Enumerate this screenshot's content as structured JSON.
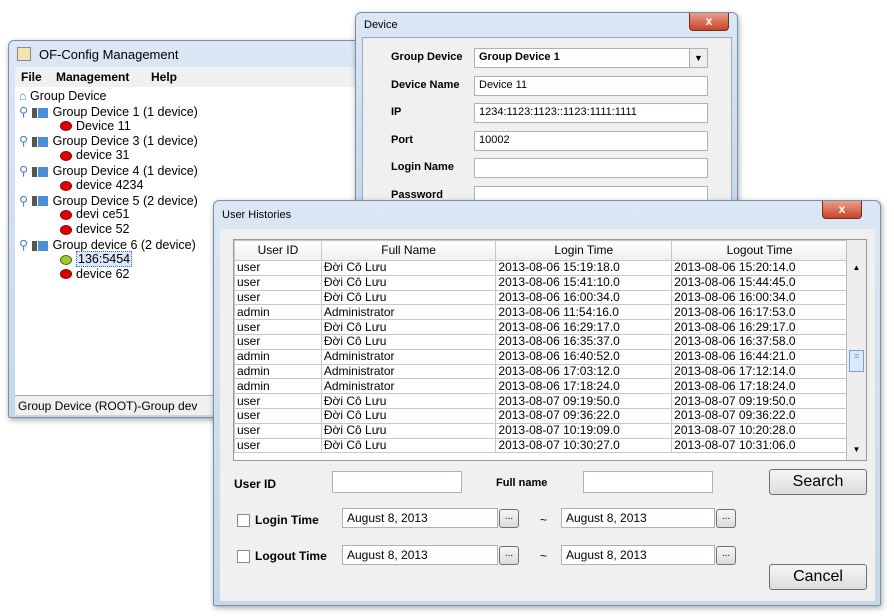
{
  "main_window": {
    "title": "OF-Config Management",
    "menu": [
      "File",
      "Management",
      "Help"
    ],
    "tree": {
      "root": "Group Device",
      "groups": [
        {
          "label": "Group Device 1 (1 device)",
          "devices": [
            {
              "name": "Device 11",
              "status": "offline"
            }
          ]
        },
        {
          "label": "Group Device 3 (1 device)",
          "devices": [
            {
              "name": "device 31",
              "status": "offline"
            }
          ]
        },
        {
          "label": "Group Device 4 (1 device)",
          "devices": [
            {
              "name": "device 4234",
              "status": "offline"
            }
          ]
        },
        {
          "label": "Group Device 5 (2 device)",
          "devices": [
            {
              "name": "devi ce51",
              "status": "offline"
            },
            {
              "name": "device 52",
              "status": "offline"
            }
          ]
        },
        {
          "label": "Group device 6 (2 device)",
          "devices": [
            {
              "name": "136:5454",
              "status": "online",
              "selected": true
            },
            {
              "name": "device 62",
              "status": "offline"
            }
          ]
        }
      ]
    },
    "status": "Group Device (ROOT)-Group dev"
  },
  "device_dialog": {
    "title": "Device",
    "close": "x",
    "fields": [
      {
        "label": "Group Device",
        "value": "Group Device 1",
        "type": "select"
      },
      {
        "label": "Device Name",
        "value": "Device 11"
      },
      {
        "label": "IP",
        "value": "1234:1123:1123::1123:1111:1111"
      },
      {
        "label": "Port",
        "value": "10002"
      },
      {
        "label": "Login Name",
        "value": ""
      },
      {
        "label": "Password",
        "value": ""
      }
    ]
  },
  "histories": {
    "title": "User Histories",
    "close": "x",
    "columns": [
      "User ID",
      "Full Name",
      "Login Time",
      "Logout Time"
    ],
    "rows": [
      [
        "user",
        "Đời Cô Lưu",
        "2013-08-06 15:19:18.0",
        "2013-08-06 15:20:14.0"
      ],
      [
        "user",
        "Đời Cô Lưu",
        "2013-08-06 15:41:10.0",
        "2013-08-06 15:44:45.0"
      ],
      [
        "user",
        "Đời Cô Lưu",
        "2013-08-06 16:00:34.0",
        "2013-08-06 16:00:34.0"
      ],
      [
        "admin",
        "Administrator",
        "2013-08-06 11:54:16.0",
        "2013-08-06 16:17:53.0"
      ],
      [
        "user",
        "Đời Cô Lưu",
        "2013-08-06 16:29:17.0",
        "2013-08-06 16:29:17.0"
      ],
      [
        "user",
        "Đời Cô Lưu",
        "2013-08-06 16:35:37.0",
        "2013-08-06 16:37:58.0"
      ],
      [
        "admin",
        "Administrator",
        "2013-08-06 16:40:52.0",
        "2013-08-06 16:44:21.0"
      ],
      [
        "admin",
        "Administrator",
        "2013-08-06 17:03:12.0",
        "2013-08-06 17:12:14.0"
      ],
      [
        "admin",
        "Administrator",
        "2013-08-06 17:18:24.0",
        "2013-08-06 17:18:24.0"
      ],
      [
        "user",
        "Đời Cô Lưu",
        "2013-08-07 09:19:50.0",
        "2013-08-07 09:19:50.0"
      ],
      [
        "user",
        "Đời Cô Lưu",
        "2013-08-07 09:36:22.0",
        "2013-08-07 09:36:22.0"
      ],
      [
        "user",
        "Đời Cô Lưu",
        "2013-08-07 10:19:09.0",
        "2013-08-07 10:20:28.0"
      ],
      [
        "user",
        "Đời Cô Lưu",
        "2013-08-07 10:30:27.0",
        "2013-08-07 10:31:06.0"
      ]
    ],
    "user_id_label": "User ID",
    "user_id_value": "",
    "full_name_label": "Full name",
    "full_name_value": "",
    "search": "Search",
    "cancel": "Cancel",
    "login_time_label": "Login Time",
    "logout_time_label": "Logout Time",
    "login_from": "August 8, 2013",
    "login_to": "August 8, 2013",
    "logout_from": "August 8, 2013",
    "logout_to": "August 8, 2013",
    "tilde": "~",
    "picker": "..."
  }
}
